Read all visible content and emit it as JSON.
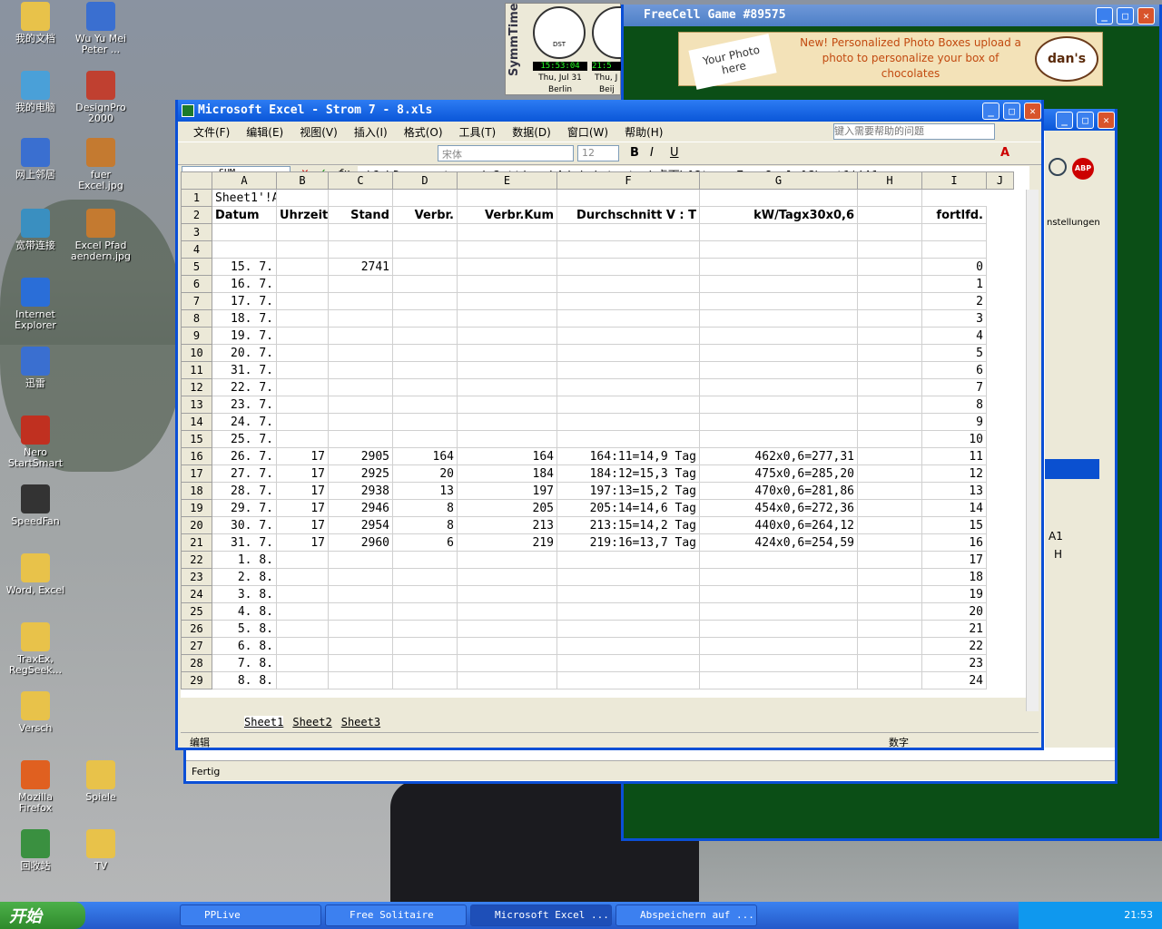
{
  "desktop": {
    "icons": [
      {
        "label": "我的文档"
      },
      {
        "label": "Wu Yu Mei Peter ..."
      },
      {
        "label": "我的电脑"
      },
      {
        "label": "DesignPro 2000"
      },
      {
        "label": "网上邻居"
      },
      {
        "label": "fuer Excel.jpg"
      },
      {
        "label": "宽带连接"
      },
      {
        "label": "Excel Pfad aendern.jpg"
      },
      {
        "label": "Internet Explorer"
      },
      {
        "label": "迅雷"
      },
      {
        "label": "Nero StartSmart"
      },
      {
        "label": "SpeedFan"
      },
      {
        "label": "Word, Excel"
      },
      {
        "label": "TraxEx, RegSeek..."
      },
      {
        "label": "Versch"
      },
      {
        "label": "Mozilla Firefox"
      },
      {
        "label": "Spiele"
      },
      {
        "label": "回收站"
      },
      {
        "label": "TV"
      }
    ]
  },
  "symmtime": {
    "brand": "SymmTime",
    "time1": "15:53:04",
    "date1": "Thu, Jul 31",
    "city1": "Berlin",
    "time2": "21:5",
    "date2": "Thu, J",
    "city2": "Beij",
    "dst": "DST"
  },
  "freecell": {
    "title": "FreeCell    Game #89575",
    "ad": "New! Personalized Photo Boxes upload a photo to personalize your box of chocolates",
    "ad_photo": "Your Photo here",
    "ad_brand": "dan's"
  },
  "browser": {
    "status": "Fertig",
    "label": "nstellungen",
    "cellref": "A1",
    "colH": "H"
  },
  "excel": {
    "title": "Microsoft Excel - Strom 7 - 8.xls",
    "menu": [
      "文件(F)",
      "编辑(E)",
      "视图(V)",
      "插入(I)",
      "格式(O)",
      "工具(T)",
      "数据(D)",
      "窗口(W)",
      "帮助(H)"
    ],
    "help_placeholder": "键入需要帮助的问题",
    "font": "宋体",
    "size": "12",
    "namebox": "SUM",
    "formula": "='C:\\Documents and Settings\\Administrator\\桌面\\[Strom 7 - 8.xls]Sheet1'!A1",
    "cols": [
      "A",
      "B",
      "C",
      "D",
      "E",
      "F",
      "G",
      "H",
      "I",
      "J"
    ],
    "rows": [
      [
        "1",
        "Sheet1'!A",
        "",
        "",
        "",
        "",
        "",
        "",
        ""
      ],
      [
        "2",
        "Datum",
        "Uhrzeit",
        "Stand",
        "Verbr.",
        "Verbr.Kum",
        "Durchschnitt V : T",
        "kW/Tagx30x0,6",
        "",
        "fortlfd."
      ],
      [
        "3",
        "",
        "",
        "",
        "",
        "",
        "",
        "",
        "",
        ""
      ],
      [
        "4",
        "",
        "",
        "",
        "",
        "",
        "",
        "",
        "",
        ""
      ],
      [
        "5",
        "15. 7.",
        "",
        "2741",
        "",
        "",
        "",
        "",
        "",
        "0"
      ],
      [
        "6",
        "16. 7.",
        "",
        "",
        "",
        "",
        "",
        "",
        "",
        "1"
      ],
      [
        "7",
        "17. 7.",
        "",
        "",
        "",
        "",
        "",
        "",
        "",
        "2"
      ],
      [
        "8",
        "18. 7.",
        "",
        "",
        "",
        "",
        "",
        "",
        "",
        "3"
      ],
      [
        "9",
        "19. 7.",
        "",
        "",
        "",
        "",
        "",
        "",
        "",
        "4"
      ],
      [
        "10",
        "20. 7.",
        "",
        "",
        "",
        "",
        "",
        "",
        "",
        "5"
      ],
      [
        "11",
        "31. 7.",
        "",
        "",
        "",
        "",
        "",
        "",
        "",
        "6"
      ],
      [
        "12",
        "22. 7.",
        "",
        "",
        "",
        "",
        "",
        "",
        "",
        "7"
      ],
      [
        "13",
        "23. 7.",
        "",
        "",
        "",
        "",
        "",
        "",
        "",
        "8"
      ],
      [
        "14",
        "24. 7.",
        "",
        "",
        "",
        "",
        "",
        "",
        "",
        "9"
      ],
      [
        "15",
        "25. 7.",
        "",
        "",
        "",
        "",
        "",
        "",
        "",
        "10"
      ],
      [
        "16",
        "26. 7.",
        "17",
        "2905",
        "164",
        "164",
        "164:11=14,9 Tag",
        "462x0,6=277,31",
        "",
        "11"
      ],
      [
        "17",
        "27. 7.",
        "17",
        "2925",
        "20",
        "184",
        "184:12=15,3 Tag",
        "475x0,6=285,20",
        "",
        "12"
      ],
      [
        "18",
        "28. 7.",
        "17",
        "2938",
        "13",
        "197",
        "197:13=15,2 Tag",
        "470x0,6=281,86",
        "",
        "13"
      ],
      [
        "19",
        "29. 7.",
        "17",
        "2946",
        "8",
        "205",
        "205:14=14,6 Tag",
        "454x0,6=272,36",
        "",
        "14"
      ],
      [
        "20",
        "30. 7.",
        "17",
        "2954",
        "8",
        "213",
        "213:15=14,2 Tag",
        "440x0,6=264,12",
        "",
        "15"
      ],
      [
        "21",
        "31. 7.",
        "17",
        "2960",
        "6",
        "219",
        "219:16=13,7 Tag",
        "424x0,6=254,59",
        "",
        "16"
      ],
      [
        "22",
        "1. 8.",
        "",
        "",
        "",
        "",
        "",
        "",
        "",
        "17"
      ],
      [
        "23",
        "2. 8.",
        "",
        "",
        "",
        "",
        "",
        "",
        "",
        "18"
      ],
      [
        "24",
        "3. 8.",
        "",
        "",
        "",
        "",
        "",
        "",
        "",
        "19"
      ],
      [
        "25",
        "4. 8.",
        "",
        "",
        "",
        "",
        "",
        "",
        "",
        "20"
      ],
      [
        "26",
        "5. 8.",
        "",
        "",
        "",
        "",
        "",
        "",
        "",
        "21"
      ],
      [
        "27",
        "6. 8.",
        "",
        "",
        "",
        "",
        "",
        "",
        "",
        "22"
      ],
      [
        "28",
        "7. 8.",
        "",
        "",
        "",
        "",
        "",
        "",
        "",
        "23"
      ],
      [
        "29",
        "8. 8.",
        "",
        "",
        "",
        "",
        "",
        "",
        "",
        "24"
      ]
    ],
    "sheets": [
      "Sheet1",
      "Sheet2",
      "Sheet3"
    ],
    "status_left": "编辑",
    "status_mid": "数字"
  },
  "taskbar": {
    "start": "开始",
    "tasks": [
      "PPLive",
      "Free Solitaire",
      "Microsoft Excel ...",
      "Abspeichern auf ..."
    ],
    "clock": "21:53"
  }
}
